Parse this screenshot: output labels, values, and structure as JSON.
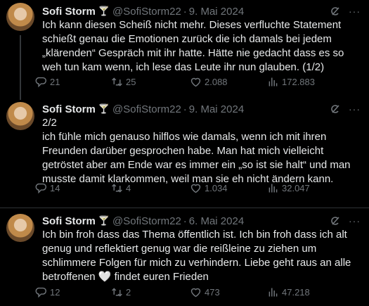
{
  "tweets": [
    {
      "name": "Sofi Storm",
      "emoji": "🍸",
      "handle": "@SofiStorm22",
      "date": "9. Mai 2024",
      "text": "Ich kann diesen Scheiß nicht mehr. Dieses verfluchte  Statement schießt genau die Emotionen zurück die ich damals bei jedem „klärenden“ Gespräch mit ihr hatte. Hätte nie gedacht dass es so weh tun kam wenn, ich lese das Leute ihr nun glauben. (1/2)",
      "replies": "21",
      "reposts": "25",
      "likes": "2.088",
      "views": "172.883"
    },
    {
      "name": "Sofi Storm",
      "emoji": "🍸",
      "handle": "@SofiStorm22",
      "date": "9. Mai 2024",
      "text": "2/2\nich fühle mich genauso hilflos wie damals, wenn ich mit ihren Freunden darüber gesprochen habe. Man hat mich vielleicht getröstet aber am Ende war es immer ein „so ist sie halt“ und man musste damit klarkommen, weil man sie eh nicht ändern kann.",
      "replies": "14",
      "reposts": "4",
      "likes": "1.034",
      "views": "32.047"
    },
    {
      "name": "Sofi Storm",
      "emoji": "🍸",
      "handle": "@SofiStorm22",
      "date": "6. Mai 2024",
      "text": "Ich bin froh dass das Thema öffentlich ist. Ich bin froh dass ich alt genug und reflektiert genug war die reißleine zu ziehen um schlimmere Folgen für mich zu verhindern. Liebe geht raus an alle betroffenen 🤍 findet euren Frieden",
      "replies": "12",
      "reposts": "2",
      "likes": "473",
      "views": "47.218"
    }
  ],
  "icons": {
    "more": "more-dots-icon",
    "grok": "grok-icon",
    "reply": "reply-icon",
    "repost": "repost-icon",
    "like": "heart-icon",
    "views": "views-chart-icon",
    "bookmark": "bookmark-icon",
    "share": "share-icon"
  },
  "colors": {
    "background": "#000000",
    "text": "#e7e9ea",
    "muted": "#71767b",
    "divider": "#2f3336"
  }
}
